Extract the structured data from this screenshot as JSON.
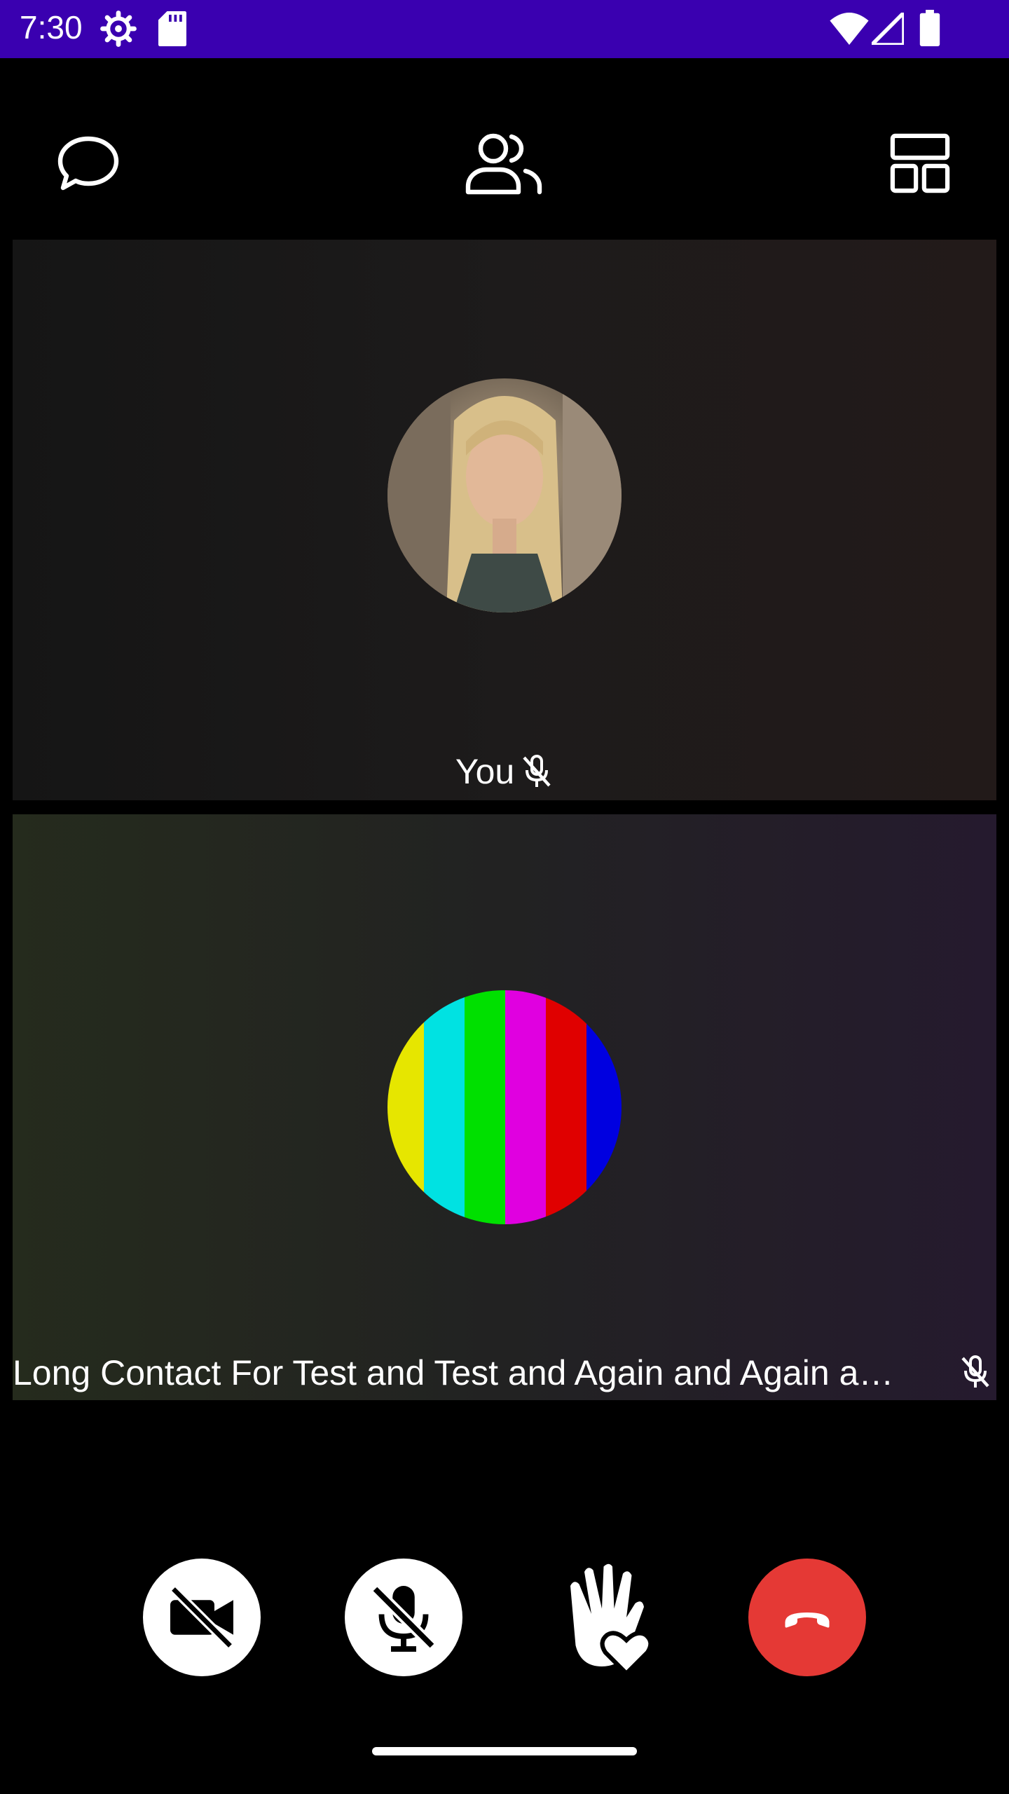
{
  "status_bar": {
    "time": "7:30",
    "background": "#3a00b0",
    "icons": [
      "settings-gear-icon",
      "sd-card-icon",
      "wifi-icon",
      "signal-icon",
      "battery-icon"
    ]
  },
  "toolbar": {
    "icons": [
      "chat-icon",
      "participants-icon",
      "layout-icon"
    ]
  },
  "tiles": [
    {
      "name": "You",
      "mic_muted": true,
      "avatar": "profile-photo"
    },
    {
      "name": "Long Contact For Test and Test and Again and Again a…",
      "mic_muted": true,
      "avatar": "color-bars-test-pattern"
    }
  ],
  "controls": {
    "camera": "camera-off-icon",
    "microphone": "mic-off-icon",
    "reaction": "raise-hand-heart-icon",
    "end_call": "hang-up-icon",
    "end_call_color": "#e53935"
  }
}
